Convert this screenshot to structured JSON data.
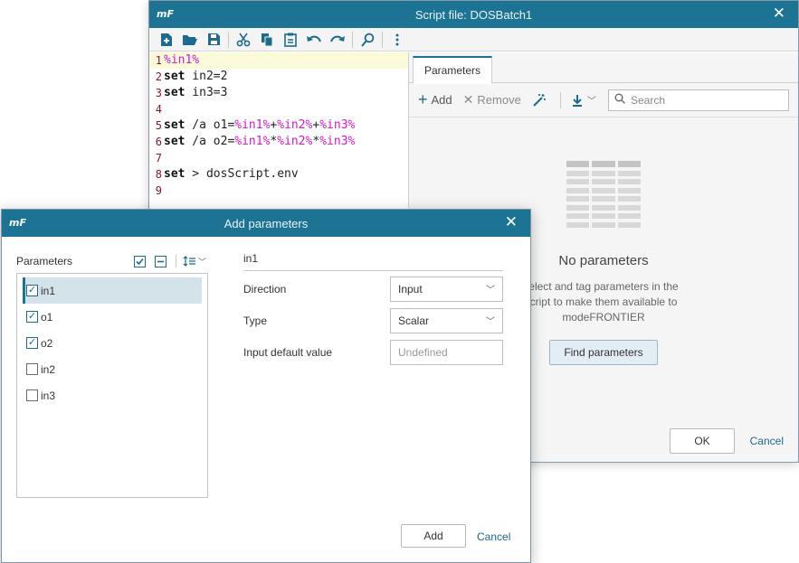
{
  "script_window": {
    "logo": "mF",
    "title": "Script file: DOSBatch1",
    "close_glyph": "✕",
    "toolbar": [
      {
        "icon": "new-file-icon"
      },
      {
        "icon": "open-folder-icon"
      },
      {
        "icon": "save-icon"
      },
      {
        "icon": "cut-icon"
      },
      {
        "icon": "copy-icon"
      },
      {
        "icon": "paste-icon"
      },
      {
        "icon": "undo-icon"
      },
      {
        "icon": "redo-icon"
      },
      {
        "icon": "find-icon"
      },
      {
        "icon": "more-vertical-icon"
      }
    ],
    "editor_lines": [
      {
        "num": "1",
        "text": "%in1%"
      },
      {
        "num": "2",
        "text": "set in2=2"
      },
      {
        "num": "3",
        "text": "set in3=3"
      },
      {
        "num": "4",
        "text": ""
      },
      {
        "num": "5",
        "text": "set /a o1=%in1%+%in2%+%in3%"
      },
      {
        "num": "6",
        "text": "set /a o2=%in1%*%in2%*%in3%"
      },
      {
        "num": "7",
        "text": ""
      },
      {
        "num": "8",
        "text": "set > dosScript.env"
      },
      {
        "num": "9",
        "text": ""
      }
    ],
    "params_panel": {
      "tab_label": "Parameters",
      "add_label": "Add",
      "remove_label": "Remove",
      "search_placeholder": "Search",
      "empty_title": "No parameters",
      "empty_desc": "elect and tag parameters in the cript to make them available to modeFRONTIER",
      "find_button": "Find parameters"
    },
    "ok_label": "OK",
    "cancel_label": "Cancel"
  },
  "add_dialog": {
    "logo": "mF",
    "title": "Add parameters",
    "close_glyph": "✕",
    "list_header": "Parameters",
    "items": [
      {
        "name": "in1",
        "checked": true,
        "selected": true
      },
      {
        "name": "o1",
        "checked": true,
        "selected": false
      },
      {
        "name": "o2",
        "checked": true,
        "selected": false
      },
      {
        "name": "in2",
        "checked": false,
        "selected": false
      },
      {
        "name": "in3",
        "checked": false,
        "selected": false
      }
    ],
    "detail": {
      "param_name": "in1",
      "direction_label": "Direction",
      "direction_value": "Input",
      "type_label": "Type",
      "type_value": "Scalar",
      "default_label": "Input default value",
      "default_placeholder": "Undefined"
    },
    "add_button": "Add",
    "cancel_button": "Cancel"
  },
  "colors": {
    "titlebar": "#1c7394",
    "accent": "#1c6a8c",
    "variable": "#d01bc9",
    "line_number": "#8a1530"
  }
}
